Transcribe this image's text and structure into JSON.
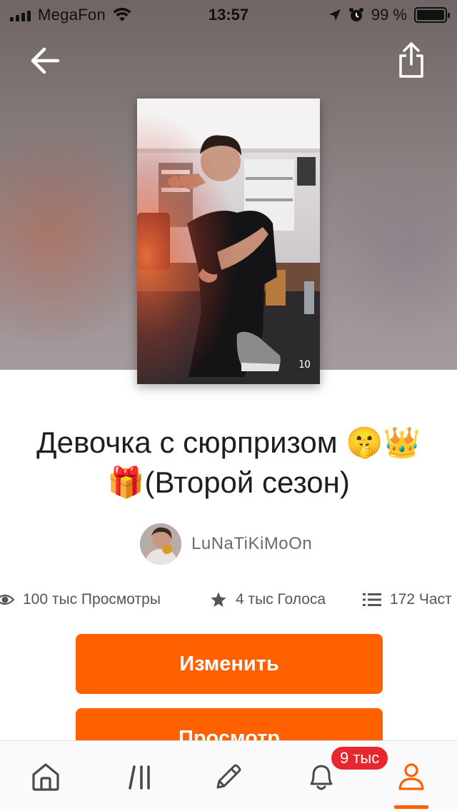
{
  "status_bar": {
    "carrier": "MegaFon",
    "time": "13:57",
    "battery": "99 %",
    "battery_level": 0.99
  },
  "header": {
    "back_icon": "arrow-left-icon",
    "share_icon": "share-icon"
  },
  "story": {
    "title": "Девочка с сюрпризом 🤫👑🎁(Второй сезон)",
    "cover_icon": "cover-image",
    "author": "LuNaTiKiMoOn"
  },
  "stats": {
    "views": "100 тыс Просмотры",
    "votes": "4 тыс Голоса",
    "parts": "172 Част"
  },
  "actions": {
    "edit": "Изменить",
    "view": "Просмотр"
  },
  "tab_bar": {
    "items": [
      "home-icon",
      "browse-icon",
      "write-icon",
      "bell-icon",
      "profile-icon"
    ],
    "notifications_badge": "9 тыс"
  },
  "colors": {
    "accent": "#ff6000",
    "badge": "#e8262e"
  }
}
